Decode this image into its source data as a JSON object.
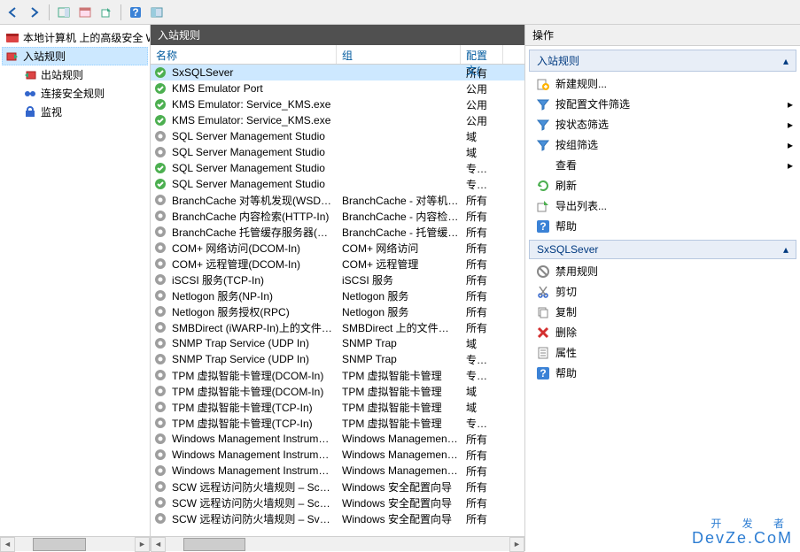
{
  "toolbar": {
    "back": "←",
    "forward": "→"
  },
  "tree": {
    "root": "本地计算机 上的高级安全 Win",
    "items": [
      {
        "label": "入站规则",
        "sel": true
      },
      {
        "label": "出站规则"
      },
      {
        "label": "连接安全规则"
      },
      {
        "label": "监视"
      }
    ]
  },
  "center": {
    "title": "入站规则",
    "columns": {
      "name": "名称",
      "group": "组",
      "profile": "配置文{"
    },
    "rows": [
      {
        "icon": "green",
        "name": "SxSQLSever",
        "group": "",
        "profile": "所有",
        "sel": true
      },
      {
        "icon": "green",
        "name": "KMS Emulator Port",
        "group": "",
        "profile": "公用"
      },
      {
        "icon": "green",
        "name": "KMS Emulator: Service_KMS.exe",
        "group": "",
        "profile": "公用"
      },
      {
        "icon": "green",
        "name": "KMS Emulator: Service_KMS.exe",
        "group": "",
        "profile": "公用"
      },
      {
        "icon": "gray",
        "name": "SQL Server Management Studio",
        "group": "",
        "profile": "域"
      },
      {
        "icon": "gray",
        "name": "SQL Server Management Studio",
        "group": "",
        "profile": "域"
      },
      {
        "icon": "green",
        "name": "SQL Server Management Studio",
        "group": "",
        "profile": "专用, 公"
      },
      {
        "icon": "green",
        "name": "SQL Server Management Studio",
        "group": "",
        "profile": "专用, 公"
      },
      {
        "icon": "gray",
        "name": "BranchCache 对等机发现(WSD-In)",
        "group": "BranchCache - 对等机发现...",
        "profile": "所有"
      },
      {
        "icon": "gray",
        "name": "BranchCache 内容检索(HTTP-In)",
        "group": "BranchCache - 内容检索(...",
        "profile": "所有"
      },
      {
        "icon": "gray",
        "name": "BranchCache 托管缓存服务器(HTTP-In)",
        "group": "BranchCache - 托管缓存服...",
        "profile": "所有"
      },
      {
        "icon": "gray",
        "name": "COM+ 网络访问(DCOM-In)",
        "group": "COM+ 网络访问",
        "profile": "所有"
      },
      {
        "icon": "gray",
        "name": "COM+ 远程管理(DCOM-In)",
        "group": "COM+ 远程管理",
        "profile": "所有"
      },
      {
        "icon": "gray",
        "name": "iSCSI 服务(TCP-In)",
        "group": "iSCSI 服务",
        "profile": "所有"
      },
      {
        "icon": "gray",
        "name": "Netlogon 服务(NP-In)",
        "group": "Netlogon 服务",
        "profile": "所有"
      },
      {
        "icon": "gray",
        "name": "Netlogon 服务授权(RPC)",
        "group": "Netlogon 服务",
        "profile": "所有"
      },
      {
        "icon": "gray",
        "name": "SMBDirect (iWARP-In)上的文件和打印...",
        "group": "SMBDirect 上的文件和打印...",
        "profile": "所有"
      },
      {
        "icon": "gray",
        "name": "SNMP Trap Service (UDP In)",
        "group": "SNMP Trap",
        "profile": "域"
      },
      {
        "icon": "gray",
        "name": "SNMP Trap Service (UDP In)",
        "group": "SNMP Trap",
        "profile": "专用, 公"
      },
      {
        "icon": "gray",
        "name": "TPM 虚拟智能卡管理(DCOM-In)",
        "group": "TPM 虚拟智能卡管理",
        "profile": "专用, 公"
      },
      {
        "icon": "gray",
        "name": "TPM 虚拟智能卡管理(DCOM-In)",
        "group": "TPM 虚拟智能卡管理",
        "profile": "域"
      },
      {
        "icon": "gray",
        "name": "TPM 虚拟智能卡管理(TCP-In)",
        "group": "TPM 虚拟智能卡管理",
        "profile": "域"
      },
      {
        "icon": "gray",
        "name": "TPM 虚拟智能卡管理(TCP-In)",
        "group": "TPM 虚拟智能卡管理",
        "profile": "专用, 公"
      },
      {
        "icon": "gray",
        "name": "Windows Management Instrumentati...",
        "group": "Windows Management In...",
        "profile": "所有"
      },
      {
        "icon": "gray",
        "name": "Windows Management Instrumentati...",
        "group": "Windows Management In...",
        "profile": "所有"
      },
      {
        "icon": "gray",
        "name": "Windows Management Instrumentati...",
        "group": "Windows Management In...",
        "profile": "所有"
      },
      {
        "icon": "gray",
        "name": "SCW 远程访问防火墙规则 – Scshost - ...",
        "group": "Windows 安全配置向导",
        "profile": "所有"
      },
      {
        "icon": "gray",
        "name": "SCW 远程访问防火墙规则 – Scshost - ...",
        "group": "Windows 安全配置向导",
        "profile": "所有"
      },
      {
        "icon": "gray",
        "name": "SCW 远程访问防火墙规则 – Svchost - T...",
        "group": "Windows 安全配置向导",
        "profile": "所有"
      }
    ]
  },
  "right": {
    "header": "操作",
    "group1": {
      "title": "入站规则",
      "items": [
        {
          "icon": "new-rule",
          "label": "新建规则...",
          "arrow": false
        },
        {
          "icon": "filter",
          "label": "按配置文件筛选",
          "arrow": true
        },
        {
          "icon": "filter",
          "label": "按状态筛选",
          "arrow": true
        },
        {
          "icon": "filter",
          "label": "按组筛选",
          "arrow": true
        },
        {
          "icon": "none",
          "label": "查看",
          "arrow": true
        },
        {
          "icon": "refresh",
          "label": "刷新",
          "arrow": false
        },
        {
          "icon": "export",
          "label": "导出列表...",
          "arrow": false
        },
        {
          "icon": "help",
          "label": "帮助",
          "arrow": false
        }
      ]
    },
    "group2": {
      "title": "SxSQLSever",
      "items": [
        {
          "icon": "disable",
          "label": "禁用规则"
        },
        {
          "icon": "cut",
          "label": "剪切"
        },
        {
          "icon": "copy",
          "label": "复制"
        },
        {
          "icon": "delete",
          "label": "删除"
        },
        {
          "icon": "props",
          "label": "属性"
        },
        {
          "icon": "help",
          "label": "帮助"
        }
      ]
    }
  },
  "watermark": {
    "line1": "开 发 者",
    "line2": "DevZe.CoM"
  }
}
